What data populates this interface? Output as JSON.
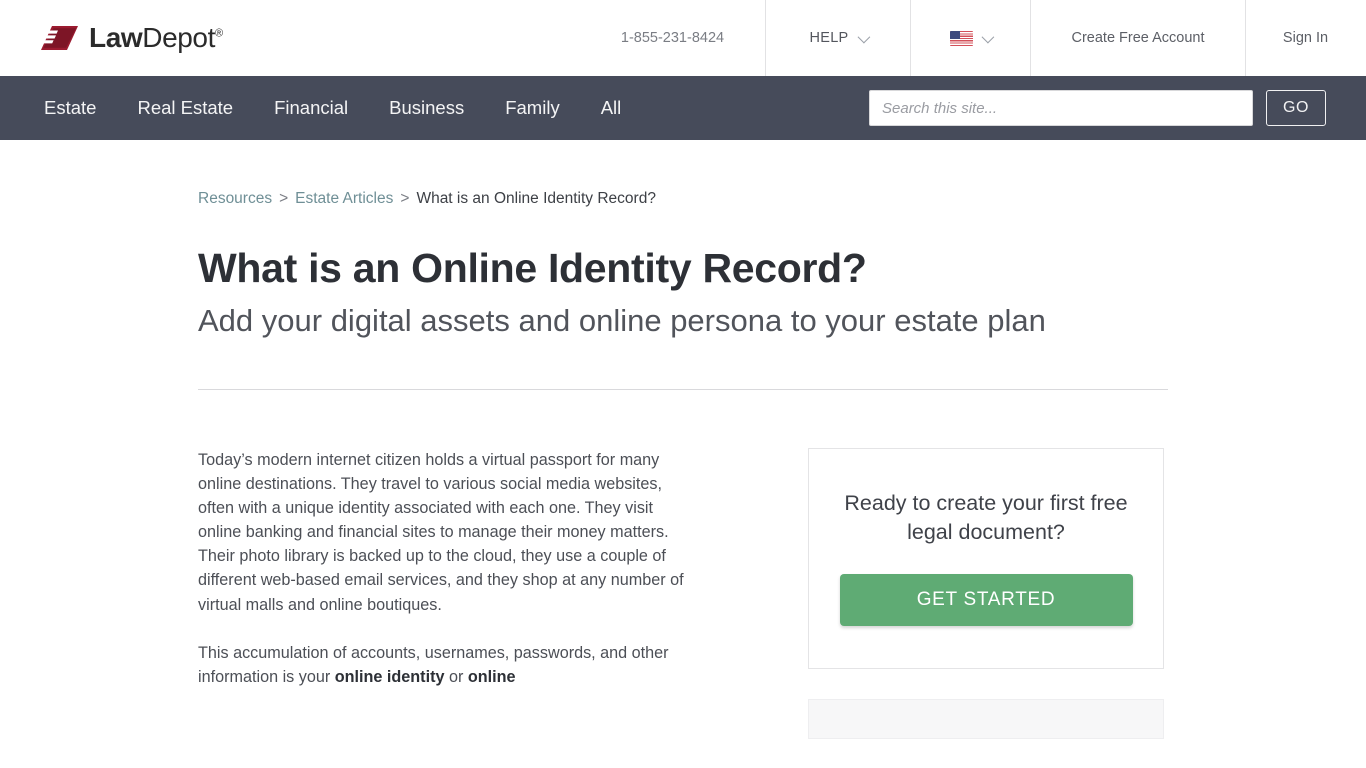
{
  "brand": {
    "name_bold": "Law",
    "name_light": "Depot",
    "registered": "®",
    "logo_icon": "lawdepot-arrow-logo",
    "logo_color": "#9b1b30"
  },
  "topbar": {
    "phone": "1-855-231-8424",
    "help_label": "HELP",
    "help_chevron": "chevron-down-icon",
    "locale_flag": "us-flag-icon",
    "locale_chevron": "chevron-down-icon",
    "create_account_label": "Create Free Account",
    "sign_in_label": "Sign In"
  },
  "nav": {
    "items": [
      {
        "label": "Estate"
      },
      {
        "label": "Real Estate"
      },
      {
        "label": "Financial"
      },
      {
        "label": "Business"
      },
      {
        "label": "Family"
      },
      {
        "label": "All"
      }
    ],
    "search": {
      "placeholder": "Search this site...",
      "value": "",
      "go_label": "GO"
    },
    "background_color": "#464b5a"
  },
  "breadcrumb": {
    "items": [
      {
        "label": "Resources",
        "link": true
      },
      {
        "label": "Estate Articles",
        "link": true
      },
      {
        "label": "What is an Online Identity Record?",
        "link": false
      }
    ],
    "separator": ">"
  },
  "article": {
    "title": "What is an Online Identity Record?",
    "subtitle": "Add your digital assets and online persona to your estate plan",
    "paragraph_1": "Today’s modern internet citizen holds a virtual passport for many online destinations. They travel to various social media websites, often with a unique identity associated with each one. They visit online banking and financial sites to manage their money matters. Their photo library is backed up to the cloud, they use a couple of different web-based email services, and they shop at any number of virtual malls and online boutiques.",
    "paragraph_2_part_1": "This accumulation of accounts, usernames, passwords, and other information is your ",
    "paragraph_2_bold_1": "online identity",
    "paragraph_2_part_2": " or ",
    "paragraph_2_bold_2": "online"
  },
  "cta": {
    "heading": "Ready to create your first free legal document?",
    "button_label": "GET STARTED",
    "button_color": "#5fab74"
  }
}
